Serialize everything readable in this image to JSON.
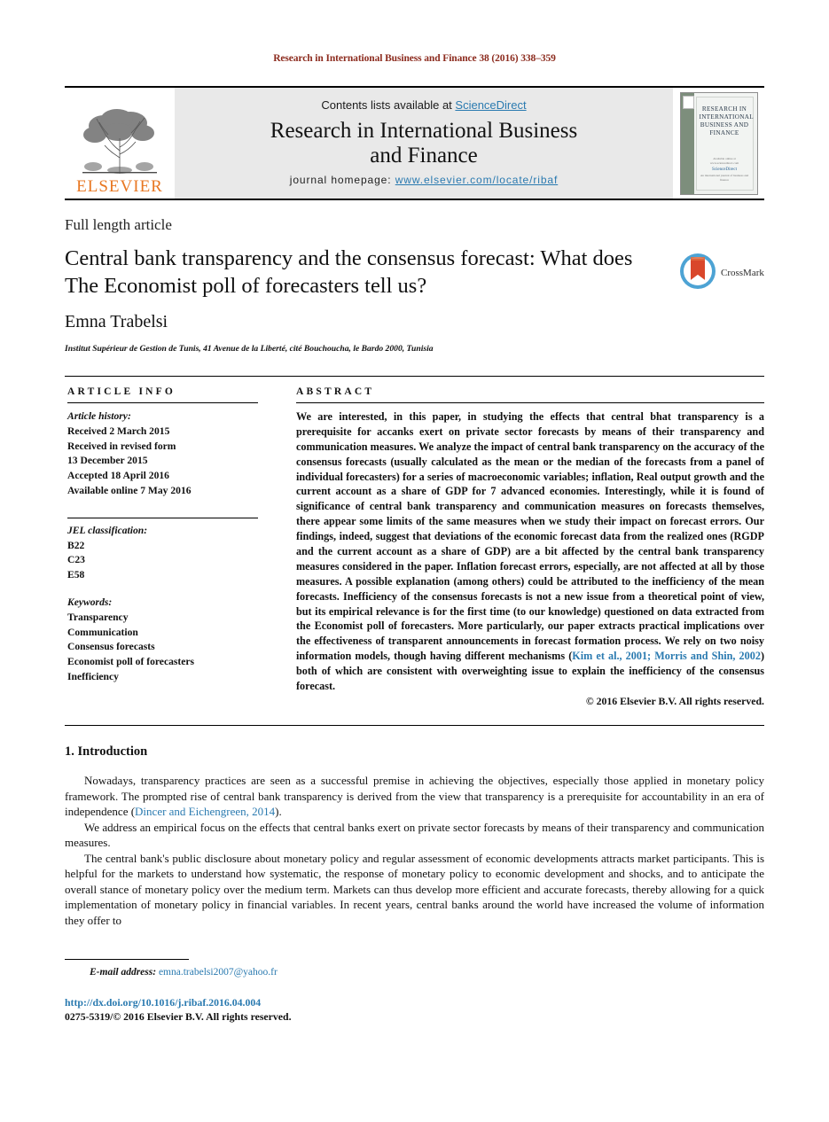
{
  "running_head": "Research in International Business and Finance 38 (2016) 338–359",
  "masthead": {
    "publisher_logo_text": "ELSEVIER",
    "publisher_logo_icon": "elsevier-tree-icon",
    "contents_prefix": "Contents lists available at ",
    "contents_link": "ScienceDirect",
    "journal_title_line1": "Research in International Business",
    "journal_title_line2": "and Finance",
    "homepage_label": "journal homepage:",
    "homepage_url": "www.elsevier.com/locate/ribaf",
    "cover": {
      "title": "RESEARCH IN INTERNATIONAL BUSINESS AND FINANCE",
      "footer_note": "Available online at www.sciencedirect.com",
      "footer_brand": "ScienceDirect",
      "footer_small": "An international journal of business and finance"
    }
  },
  "article": {
    "type": "Full length article",
    "title": "Central bank transparency and the consensus forecast: What does The Economist poll of forecasters tell us?",
    "crossmark_label": "CrossMark",
    "author": "Emna Trabelsi",
    "affiliation": "Institut Supérieur de Gestion de Tunis, 41 Avenue de la Liberté, cité Bouchoucha, le Bardo 2000, Tunisia"
  },
  "info": {
    "heading": "ARTICLE INFO",
    "history_label": "Article history:",
    "history": [
      "Received 2 March 2015",
      "Received in revised form",
      "13 December 2015",
      "Accepted 18 April 2016",
      "Available online 7 May 2016"
    ],
    "jel_label": "JEL classification:",
    "jel_codes": [
      "B22",
      "C23",
      "E58"
    ],
    "keywords_label": "Keywords:",
    "keywords": [
      "Transparency",
      "Communication",
      "Consensus forecasts",
      "Economist poll of forecasters",
      "Inefficiency"
    ]
  },
  "abstract": {
    "heading": "ABSTRACT",
    "part1": "We are interested, in this paper, in studying the effects that central bhat transparency is a prerequisite for accanks exert on private sector forecasts by means of their transparency and communication measures. We analyze the impact of central bank transparency on the accuracy of the consensus forecasts (usually calculated as the mean or the median of the forecasts from a panel of individual forecasters) for a series of macroeconomic variables; inflation, Real output growth and the current account as a share of GDP for 7 advanced economies. Interestingly, while it is found of significance of central bank transparency and communication measures on forecasts themselves, there appear some limits of the same measures when we study their impact on forecast errors. Our findings, indeed, suggest that deviations of the economic forecast data from the realized ones (RGDP and the current account as a share of GDP) are a bit affected by the central bank transparency measures considered in the paper. Inflation forecast errors, especially, are not affected at all by those measures. A possible explanation (among others) could be attributed to the inefficiency of the mean forecasts. Inefficiency of the consensus forecasts is not a new issue from a theoretical point of view, but its empirical relevance is for the first time (to our knowledge) questioned on data extracted from the Economist poll of forecasters. More particularly, our paper extracts practical implications over the effectiveness of transparent announcements in forecast formation process. We rely on two noisy information models, though having different mechanisms (",
    "citation": "Kim et al., 2001; Morris and Shin, 2002",
    "part2": ") both of which are consistent with overweighting issue to explain the inefficiency of the consensus forecast.",
    "copyright": "© 2016 Elsevier B.V. All rights reserved."
  },
  "body": {
    "section_number_title": "1.  Introduction",
    "p1_before_cite": "Nowadays, transparency practices are seen as a successful premise in achieving the objectives, especially those applied in monetary policy framework. The prompted rise of central bank transparency is derived from the view that transparency is a prerequisite for accountability in an era of independence (",
    "p1_cite": "Dincer and Eichengreen, 2014",
    "p1_after_cite": ").",
    "p2": "We address an empirical focus on the effects that central banks exert on private sector forecasts by means of their transparency and communication measures.",
    "p3": "The central bank's public disclosure about monetary policy and regular assessment of economic developments attracts market participants. This is helpful for the markets to understand how systematic, the response of monetary policy to economic development and shocks, and to anticipate the overall stance of monetary policy over the medium term. Markets can thus develop more efficient and accurate forecasts, thereby allowing for a quick implementation of monetary policy in financial variables. In recent years, central banks around the world have increased the volume of information they offer to"
  },
  "footnote": {
    "email_label": "E-mail address:",
    "email": "emna.trabelsi2007@yahoo.fr",
    "doi": "http://dx.doi.org/10.1016/j.ribaf.2016.04.004",
    "issn_copyright": "0275-5319/© 2016 Elsevier B.V. All rights reserved."
  },
  "colors": {
    "running_head": "#8c2b1e",
    "link": "#2a7ab0",
    "elsevier_orange": "#e87722",
    "masthead_bg": "#e9e9e9"
  }
}
